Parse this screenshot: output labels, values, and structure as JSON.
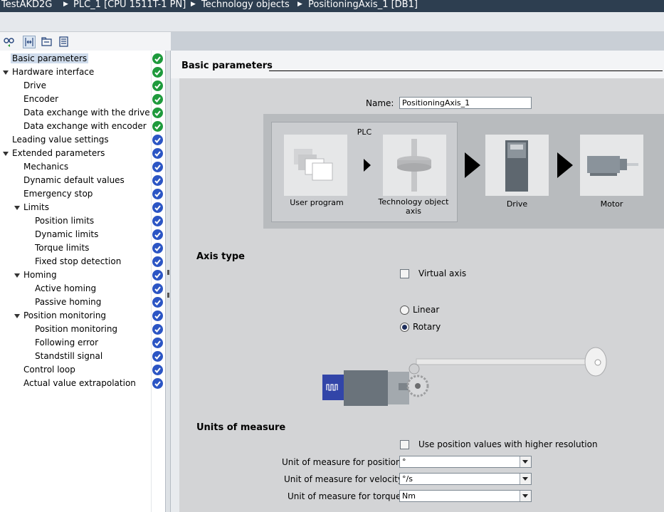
{
  "titlebar": {
    "crumbs": [
      "TestAKD2G",
      "PLC_1 [CPU 1511T-1 PN]",
      "Technology objects",
      "PositioningAxis_1 [DB1]"
    ]
  },
  "toolbar": {
    "icons": [
      "overview-icon",
      "expand-icon",
      "folder-icon",
      "tree-icon"
    ]
  },
  "nav": {
    "items": [
      {
        "label": "Basic parameters",
        "status": "ok"
      },
      {
        "label": "Hardware interface",
        "status": "ok"
      },
      {
        "label": "Drive",
        "status": "ok"
      },
      {
        "label": "Encoder",
        "status": "ok"
      },
      {
        "label": "Data exchange with the drive",
        "status": "ok"
      },
      {
        "label": "Data exchange with encoder",
        "status": "ok"
      },
      {
        "label": "Leading value settings",
        "status": "blue"
      },
      {
        "label": "Extended parameters",
        "status": "blue"
      },
      {
        "label": "Mechanics",
        "status": "blue"
      },
      {
        "label": "Dynamic default values",
        "status": "blue"
      },
      {
        "label": "Emergency stop",
        "status": "blue"
      },
      {
        "label": "Limits",
        "status": "blue"
      },
      {
        "label": "Position limits",
        "status": "blue"
      },
      {
        "label": "Dynamic limits",
        "status": "blue"
      },
      {
        "label": "Torque limits",
        "status": "blue"
      },
      {
        "label": "Fixed stop detection",
        "status": "blue"
      },
      {
        "label": "Homing",
        "status": "blue"
      },
      {
        "label": "Active homing",
        "status": "blue"
      },
      {
        "label": "Passive homing",
        "status": "blue"
      },
      {
        "label": "Position monitoring",
        "status": "blue"
      },
      {
        "label": "Position monitoring",
        "status": "blue"
      },
      {
        "label": "Following error",
        "status": "blue"
      },
      {
        "label": "Standstill signal",
        "status": "blue"
      },
      {
        "label": "Control loop",
        "status": "blue"
      },
      {
        "label": "Actual value extrapolation",
        "status": "blue"
      }
    ]
  },
  "section": {
    "title": "Basic parameters"
  },
  "name_field": {
    "label": "Name:",
    "value": "PositioningAxis_1"
  },
  "diagram": {
    "plc_label": "PLC",
    "user_program": "User program",
    "tech_object_line1": "Technology object",
    "tech_object_line2": "axis",
    "drive": "Drive",
    "motor": "Motor"
  },
  "axis_type": {
    "heading": "Axis type",
    "virtual_axis_label": "Virtual axis",
    "virtual_axis_checked": false,
    "linear_label": "Linear",
    "rotary_label": "Rotary",
    "selected": "Rotary"
  },
  "units": {
    "heading": "Units of measure",
    "high_res_label": "Use position values with higher resolution",
    "high_res_checked": false,
    "position_label": "Unit of measure for position:",
    "position_value": "°",
    "velocity_label": "Unit of measure for velocity:",
    "velocity_value": "°/s",
    "torque_label": "Unit of measure for torque:",
    "torque_value": "Nm"
  },
  "colors": {
    "titlebar": "#2d3e50",
    "status_ok": "#1e9a3c",
    "status_blue": "#2b55c4",
    "selected_bg": "#cfdcec"
  }
}
